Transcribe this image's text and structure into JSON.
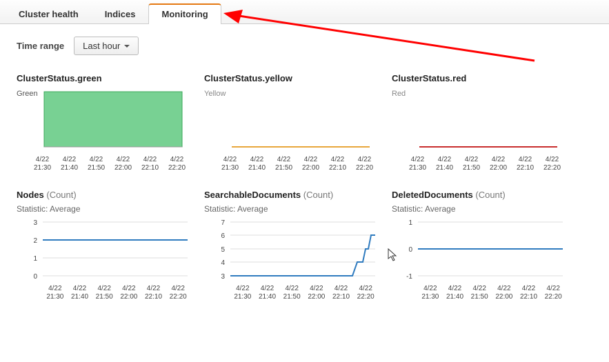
{
  "tabs": {
    "cluster_health": "Cluster health",
    "indices": "Indices",
    "monitoring": "Monitoring",
    "active": "monitoring"
  },
  "time_range": {
    "label": "Time range",
    "selected": "Last hour"
  },
  "xticks": [
    {
      "d": "4/22",
      "t": "21:30"
    },
    {
      "d": "4/22",
      "t": "21:40"
    },
    {
      "d": "4/22",
      "t": "21:50"
    },
    {
      "d": "4/22",
      "t": "22:00"
    },
    {
      "d": "4/22",
      "t": "22:10"
    },
    {
      "d": "4/22",
      "t": "22:20"
    }
  ],
  "charts": {
    "green": {
      "title": "ClusterStatus.green",
      "ylabel": "Green"
    },
    "yellow": {
      "title": "ClusterStatus.yellow",
      "ylabel": "Yellow"
    },
    "red": {
      "title": "ClusterStatus.red",
      "ylabel": "Red"
    },
    "nodes": {
      "title": "Nodes",
      "unit": "(Count)",
      "stat": "Statistic: Average",
      "yticks": [
        "3",
        "2",
        "1",
        "0"
      ]
    },
    "searchable": {
      "title": "SearchableDocuments",
      "unit": "(Count)",
      "stat": "Statistic: Average",
      "yticks": [
        "7",
        "6",
        "5",
        "4",
        "3"
      ]
    },
    "deleted": {
      "title": "DeletedDocuments",
      "unit": "(Count)",
      "stat": "Statistic: Average",
      "yticks": [
        "1",
        "0",
        "-1"
      ]
    }
  },
  "chart_data": [
    {
      "id": "cluster-status-green",
      "type": "area",
      "title": "ClusterStatus.green",
      "x": [
        "21:30",
        "21:40",
        "21:50",
        "22:00",
        "22:10",
        "22:20"
      ],
      "values": [
        1,
        1,
        1,
        1,
        1,
        1
      ],
      "ylim": [
        0,
        1
      ],
      "color": "#6bcf8b"
    },
    {
      "id": "cluster-status-yellow",
      "type": "area",
      "title": "ClusterStatus.yellow",
      "x": [
        "21:30",
        "21:40",
        "21:50",
        "22:00",
        "22:10",
        "22:20"
      ],
      "values": [
        0,
        0,
        0,
        0,
        0,
        0
      ],
      "ylim": [
        0,
        1
      ],
      "color": "#e8a63b"
    },
    {
      "id": "cluster-status-red",
      "type": "area",
      "title": "ClusterStatus.red",
      "x": [
        "21:30",
        "21:40",
        "21:50",
        "22:00",
        "22:10",
        "22:20"
      ],
      "values": [
        0,
        0,
        0,
        0,
        0,
        0
      ],
      "ylim": [
        0,
        1
      ],
      "color": "#c92d2d"
    },
    {
      "id": "nodes-count",
      "type": "line",
      "title": "Nodes (Count)",
      "statistic": "Average",
      "x": [
        "21:30",
        "21:40",
        "21:50",
        "22:00",
        "22:10",
        "22:20"
      ],
      "values": [
        2,
        2,
        2,
        2,
        2,
        2
      ],
      "ylim": [
        0,
        3
      ],
      "color": "#2f7bbf"
    },
    {
      "id": "searchable-documents-count",
      "type": "line",
      "title": "SearchableDocuments (Count)",
      "statistic": "Average",
      "x": [
        "21:30",
        "21:40",
        "21:50",
        "22:00",
        "22:10",
        "22:20",
        "22:25"
      ],
      "values": [
        3,
        3,
        3,
        3,
        3,
        4,
        6
      ],
      "ylim": [
        3,
        7
      ],
      "color": "#2f7bbf"
    },
    {
      "id": "deleted-documents-count",
      "type": "line",
      "title": "DeletedDocuments (Count)",
      "statistic": "Average",
      "x": [
        "21:30",
        "21:40",
        "21:50",
        "22:00",
        "22:10",
        "22:20"
      ],
      "values": [
        0,
        0,
        0,
        0,
        0,
        0
      ],
      "ylim": [
        -1,
        1
      ],
      "color": "#2f7bbf"
    }
  ]
}
